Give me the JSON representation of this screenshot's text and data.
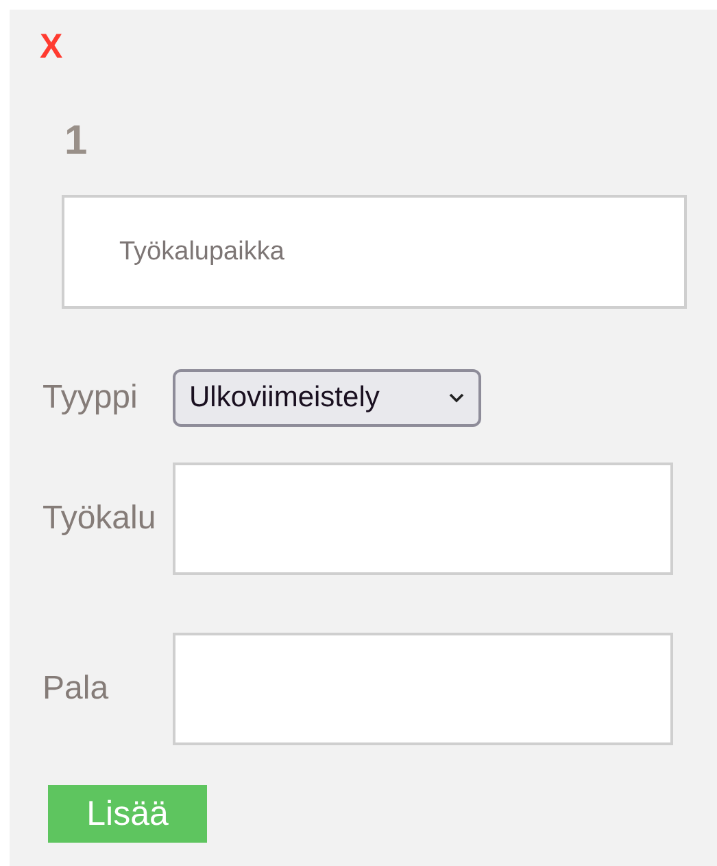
{
  "close": "X",
  "number": "1",
  "location_field": {
    "placeholder": "Työkalupaikka"
  },
  "fields": [
    {
      "kind": "select",
      "label": "Tyyppi",
      "value": "Ulkoviimeistely"
    },
    {
      "kind": "input",
      "label": "Työkalu"
    },
    {
      "kind": "input",
      "label": "Pala"
    }
  ],
  "add_button": "Lisää"
}
